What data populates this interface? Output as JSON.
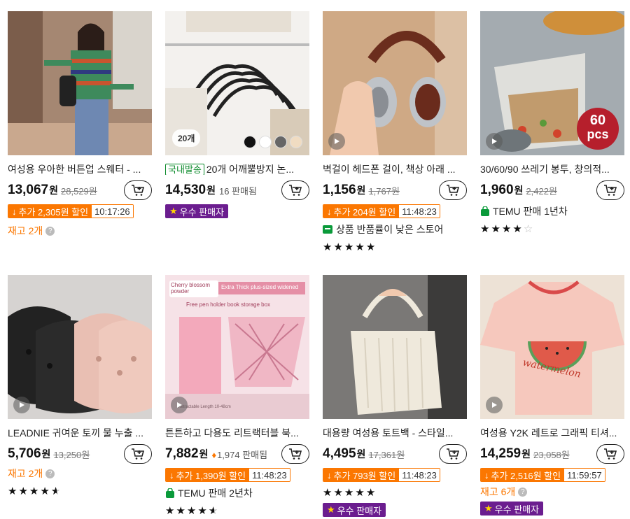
{
  "products": [
    {
      "title": "여성용 우아한 버튼업 스웨터 - ...",
      "price": "13,067",
      "won": "원",
      "old_price": "28,529원",
      "promo": {
        "label": "추가 2,305원 할인",
        "time": "10:17:26"
      },
      "stock": "재고 2개"
    },
    {
      "domestic_tag": "국내발송",
      "title": "20개 어깨뿔방지 논...",
      "price": "14,530",
      "won": "원",
      "sold": "16 판매됨",
      "thumb_badge": "20개",
      "badge": "우수 판매자"
    },
    {
      "title": "벽걸이 헤드폰 걸이, 책상 아래 ...",
      "price": "1,156",
      "won": "원",
      "old_price": "1,767원",
      "promo": {
        "label": "추가 204원 할인",
        "time": "11:48:23"
      },
      "low_return": "상품 반품률이 낮은 스토어",
      "rating": 5
    },
    {
      "title": "30/60/90 쓰레기 봉투, 창의적...",
      "price": "1,960",
      "won": "원",
      "old_price": "2,422원",
      "pcs": {
        "number": "60",
        "unit": "pcs"
      },
      "seller": "TEMU 판매 1년차",
      "rating": 4
    },
    {
      "title": "LEADNIE 귀여운 토끼 물 누출 ...",
      "price": "5,706",
      "won": "원",
      "old_price": "13,250원",
      "stock": "재고 2개",
      "rating": 4.5
    },
    {
      "title": "튼튼하고 다용도 리트랙터블 북...",
      "price": "7,882",
      "won": "원",
      "sold": "1,974 판매됨",
      "promo": {
        "label": "추가 1,390원 할인",
        "time": "11:48:23"
      },
      "seller": "TEMU 판매 2년차",
      "rating": 4.5,
      "thumb_texts": {
        "t1": "Cherry blossom powder",
        "t2": "Extra Thick plus-sized widened",
        "t3": "Free pen holder book storage box"
      }
    },
    {
      "title": "대용량 여성용 토트백 - 스타일...",
      "price": "4,495",
      "won": "원",
      "old_price": "17,361원",
      "promo": {
        "label": "추가 793원 할인",
        "time": "11:48:23"
      },
      "rating": 5,
      "badge": "우수 판매자"
    },
    {
      "title": "여성용 Y2K 레트로 그래픽 티셔...",
      "price": "14,259",
      "won": "원",
      "old_price": "23,058원",
      "promo": {
        "label": "추가 2,516원 할인",
        "time": "11:59:57"
      },
      "stock": "재고 6개",
      "badge": "우수 판매자",
      "shirt_text": "watermelon"
    }
  ],
  "colors": {
    "accent": "#fb7701",
    "purple_badge": "#6b1d8f",
    "green": "#0a9a3a"
  }
}
